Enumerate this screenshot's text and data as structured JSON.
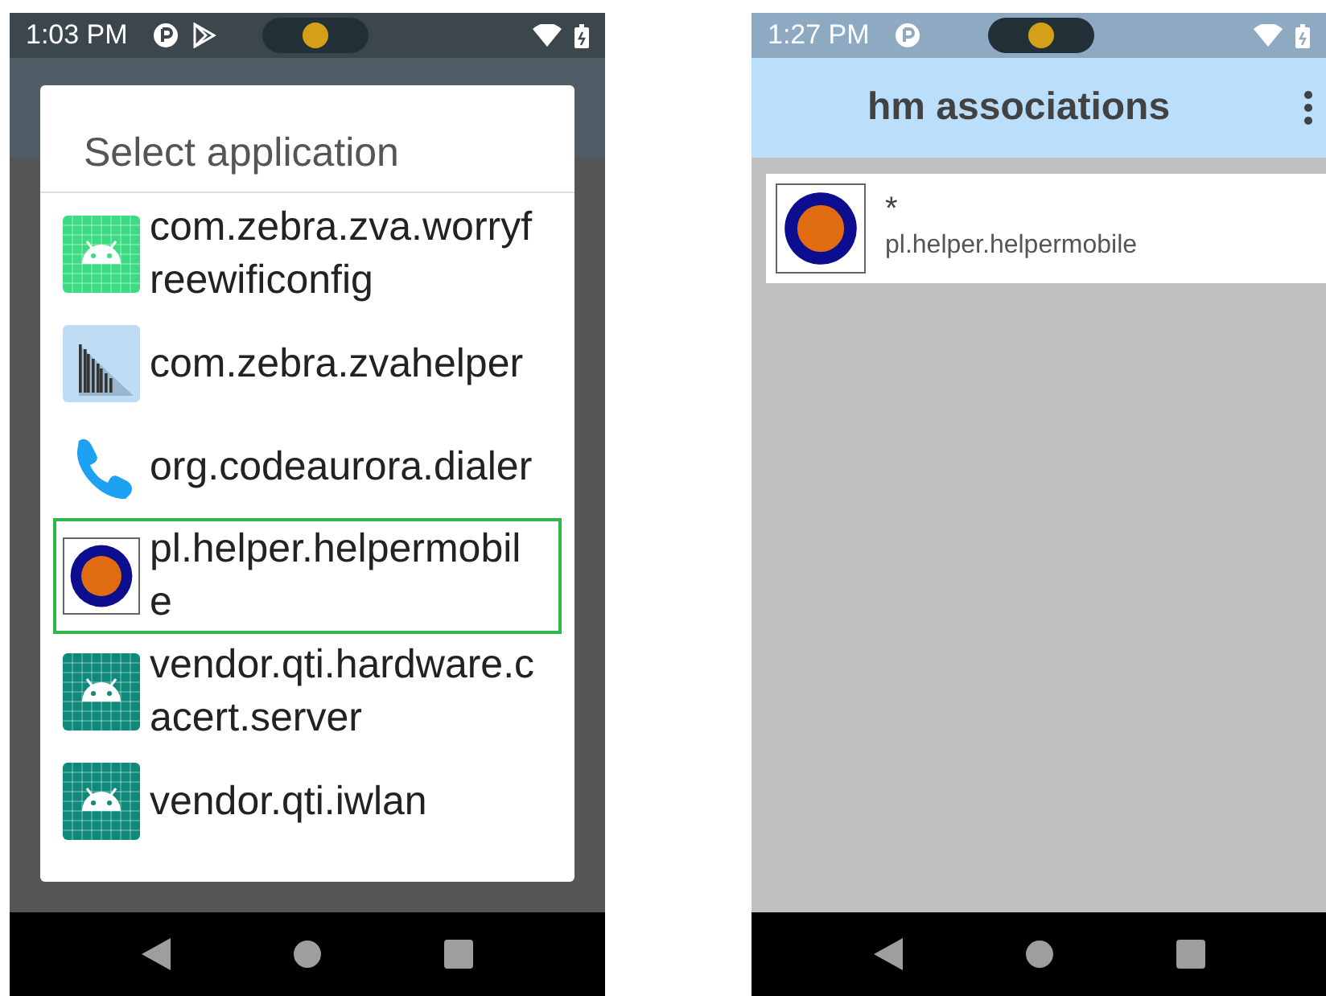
{
  "left_phone": {
    "status_bar": {
      "time": "1:03 PM"
    },
    "dialog": {
      "title": "Select application",
      "items": [
        {
          "label": "com.zebra.zva.worryfreewificonfig",
          "kind": "android",
          "color": "#3ddc84",
          "selected": false
        },
        {
          "label": "com.zebra.zvahelper",
          "kind": "barcode",
          "selected": false
        },
        {
          "label": "org.codeaurora.dialer",
          "kind": "phone",
          "selected": false
        },
        {
          "label": "pl.helper.helpermobile",
          "kind": "logo",
          "selected": true
        },
        {
          "label": "vendor.qti.hardware.cacert.server",
          "kind": "android",
          "color": "#0f8a7a",
          "selected": false
        },
        {
          "label": "vendor.qti.iwlan",
          "kind": "android",
          "color": "#0f8a7a",
          "selected": false
        }
      ]
    }
  },
  "right_phone": {
    "status_bar": {
      "time": "1:27 PM"
    },
    "app_bar": {
      "title": "hm associations"
    },
    "associations": [
      {
        "pattern": "*",
        "package": "pl.helper.helpermobile"
      }
    ]
  }
}
